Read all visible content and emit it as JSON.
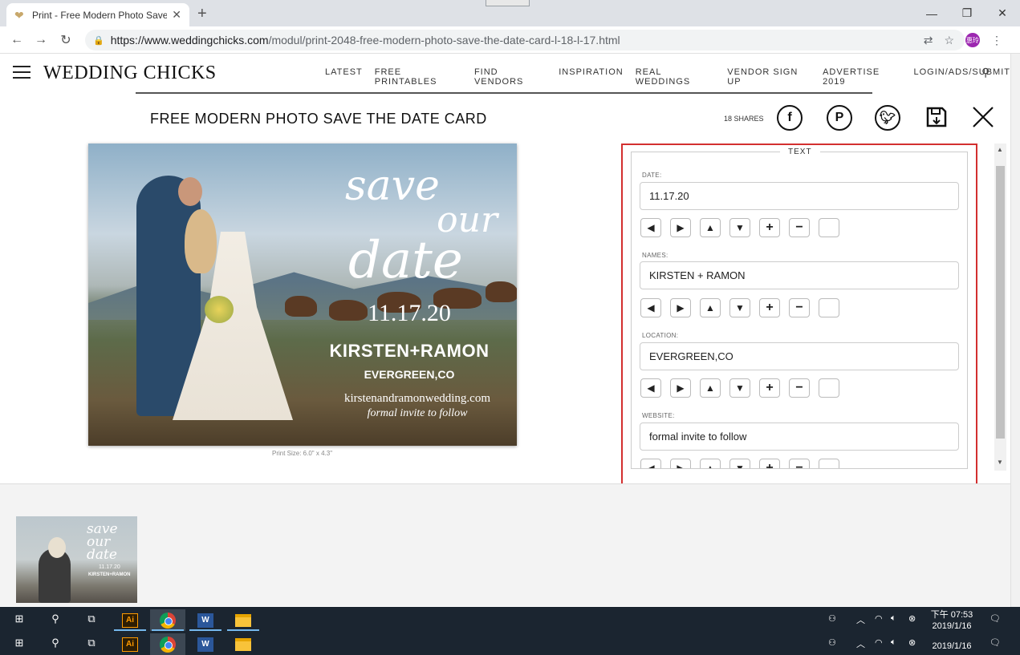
{
  "browser": {
    "tab_title": "Print - Free Modern Photo Save",
    "url_host": "https://www.weddingchicks.com",
    "url_path": "/modul/print-2048-free-modern-photo-save-the-date-card-l-18-l-17.html",
    "profile_initials": "惠玲"
  },
  "site": {
    "logo": "WEDDING CHICKS",
    "nav": [
      "LATEST",
      "FREE PRINTABLES",
      "FIND VENDORS",
      "INSPIRATION",
      "REAL WEDDINGS",
      "VENDOR SIGN UP",
      "ADVERTISE 2019",
      "LOGIN/ADS/SUBMIT"
    ]
  },
  "page": {
    "title": "FREE MODERN PHOTO SAVE THE DATE CARD",
    "shares": "18 SHARES",
    "print_size": "Print Size: 6.0\" x 4.3\""
  },
  "card": {
    "script_line1": "save",
    "script_line2": "our",
    "script_line3": "date",
    "date": "11.17.20",
    "names": "KIRSTEN+RAMON",
    "location": "EVERGREEN,CO",
    "website": "kirstenandramonwedding.com",
    "invite": "formal invite to follow"
  },
  "editor": {
    "legend": "TEXT",
    "fields": [
      {
        "label": "DATE:",
        "value": "11.17.20"
      },
      {
        "label": "NAMES:",
        "value": "KIRSTEN + RAMON"
      },
      {
        "label": "LOCATION:",
        "value": "EVERGREEN,CO"
      },
      {
        "label": "WEBSITE:",
        "value": "formal invite to follow"
      }
    ]
  },
  "thumbnail": {
    "script": "save our date",
    "date": "11.17.20",
    "names": "KIRSTEN+RAMON"
  },
  "taskbar": {
    "clock_time": "下午 07:53",
    "clock_date": "2019/1/16",
    "clock_date_2": "2019/1/16",
    "ai_label": "Ai",
    "word_label": "W"
  },
  "colors": {
    "highlight_border": "#d32f2f",
    "taskbar": "#1b2530"
  }
}
